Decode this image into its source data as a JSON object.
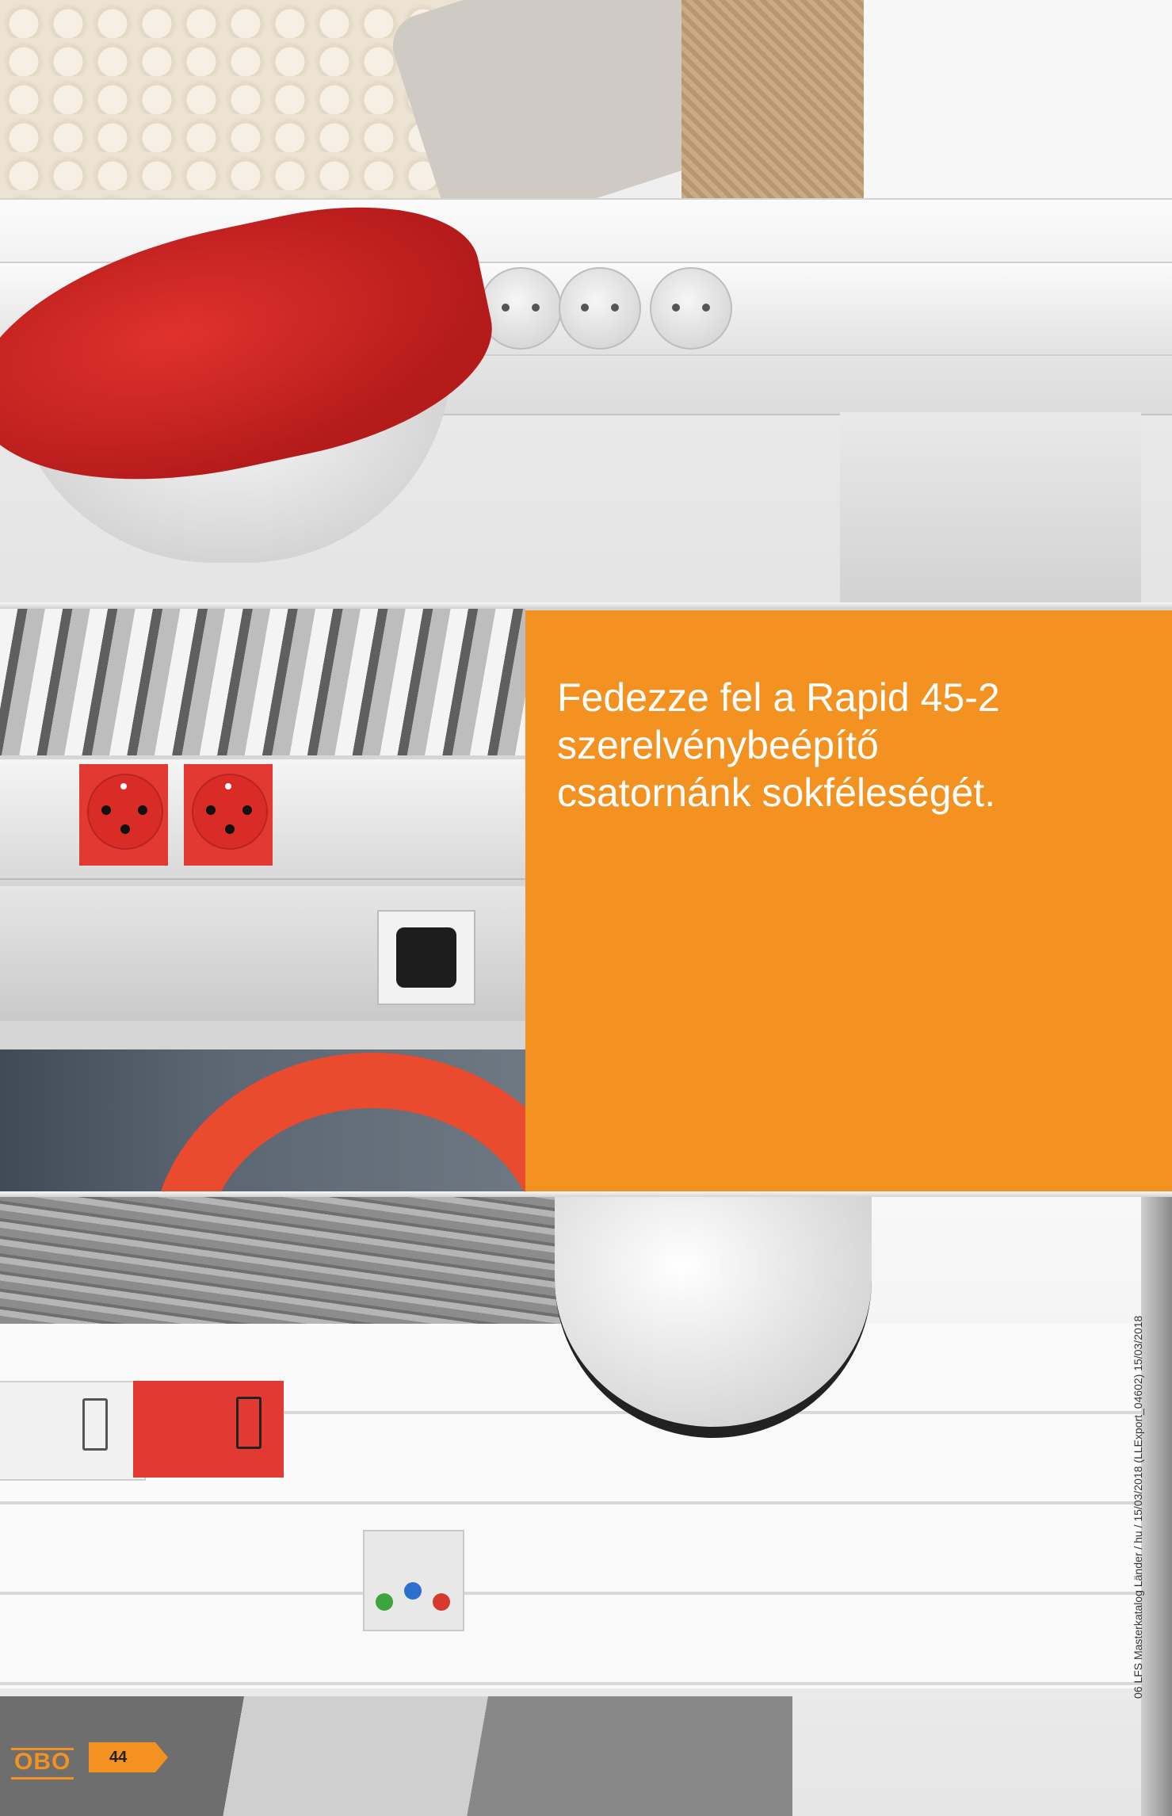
{
  "headline": {
    "line1": "Fedezze fel a Rapid 45-2",
    "line2": "szerelvénybeépítő",
    "line3": "csatornánk sokféleségét."
  },
  "footer": {
    "logo": "OBO",
    "page_number": "44"
  },
  "sidenote": "06 LFS Masterkatalog Länder / hu / 15/03/2018 (LLExport_04602) 15/03/2018",
  "colors": {
    "accent": "#f39121",
    "headline_text": "#ffffff"
  }
}
